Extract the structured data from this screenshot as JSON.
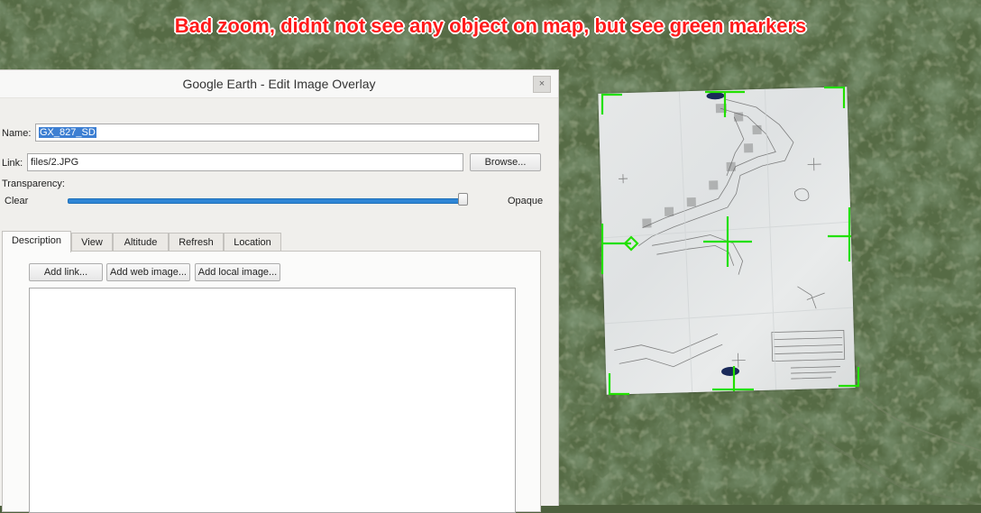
{
  "annotation": "Bad zoom, didnt not see any object on map, but see green markers",
  "colors": {
    "annotation_text": "#ff1a1a",
    "marker_green": "#22e000",
    "selection": "#3d7fd2",
    "slider": "#2f86d6"
  },
  "dialog": {
    "title": "Google Earth - Edit Image Overlay",
    "close_label": "×",
    "name_label": "Name:",
    "name_value": "GX_827_SD",
    "link_label": "Link:",
    "link_value": "files/2.JPG",
    "browse_label": "Browse...",
    "transparency_label": "Transparency:",
    "clear_label": "Clear",
    "opaque_label": "Opaque",
    "opacity_fraction": 1.0,
    "tabs": [
      {
        "label": "Description",
        "active": true
      },
      {
        "label": "View",
        "active": false
      },
      {
        "label": "Altitude",
        "active": false
      },
      {
        "label": "Refresh",
        "active": false
      },
      {
        "label": "Location",
        "active": false
      }
    ],
    "add_link_label": "Add link...",
    "add_web_image_label": "Add web image...",
    "add_local_image_label": "Add local image...",
    "description_value": ""
  },
  "icons": {
    "close": "close-icon",
    "markers": "green-corner-marker-icon"
  }
}
